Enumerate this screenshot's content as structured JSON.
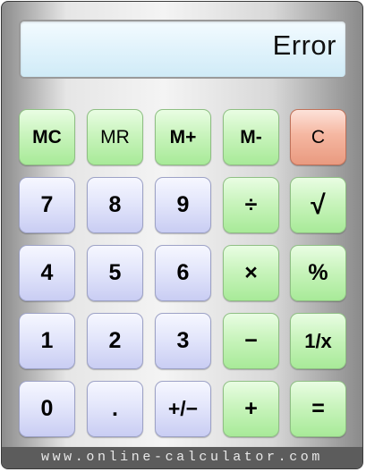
{
  "display": {
    "value": "Error"
  },
  "keys": {
    "mc": "MC",
    "mr": "MR",
    "mplus": "M+",
    "mminus": "M-",
    "clear": "C",
    "d7": "7",
    "d8": "8",
    "d9": "9",
    "divide": "÷",
    "sqrt": "√",
    "d4": "4",
    "d5": "5",
    "d6": "6",
    "multiply": "×",
    "percent": "%",
    "d1": "1",
    "d2": "2",
    "d3": "3",
    "minus": "−",
    "reciprocal": "1/x",
    "d0": "0",
    "decimal": ".",
    "negate": "+/−",
    "plus": "+",
    "equals": "="
  },
  "footer": {
    "text": "www.online-calculator.com"
  },
  "colors": {
    "digit_key": "#d6d9f7",
    "operation_key": "#c4f2b6",
    "clear_key": "#f1ab93",
    "display_bg": "#dcf1fa"
  }
}
